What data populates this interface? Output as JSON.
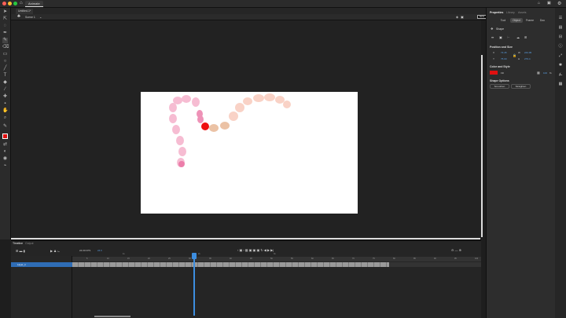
{
  "app": {
    "tab": "Animate",
    "document": "Untitled-1*",
    "scene": "Scene 1",
    "zoom": "50%"
  },
  "panel": {
    "tabs": [
      "Properties",
      "Library",
      "Assets"
    ],
    "subtabs": [
      "Tool",
      "Object",
      "Frame",
      "Doc"
    ],
    "object_type": "Shape",
    "position_size": {
      "title": "Position and Size",
      "x_label": "X",
      "x": "73.45",
      "y_label": "Y",
      "y": "75.00",
      "w_label": "W",
      "w": "243.95",
      "h_label": "H",
      "h": "279.4"
    },
    "color_style": {
      "title": "Color and Style",
      "fill_label": "Fill",
      "fill_color": "#e01010",
      "opacity": "100",
      "opacity_unit": "%"
    },
    "shape_options": {
      "title": "Shape Options",
      "smoothen": "Smoothen",
      "straighten": "Straighten"
    }
  },
  "timeline": {
    "tabs": [
      "Timeline",
      "Output"
    ],
    "fps": "24.00",
    "fps_unit": "FPS",
    "frame": "24",
    "frame_unit": "F",
    "layer": "Layer_1",
    "ruler_labels": [
      "1s",
      "2s",
      "3s"
    ],
    "frame_numbers": [
      "5",
      "10",
      "15",
      "20",
      "25",
      "30",
      "35",
      "40",
      "45",
      "50",
      "55",
      "60",
      "65",
      "70",
      "75",
      "80",
      "85",
      "90",
      "95",
      "100"
    ],
    "current_frame": 24
  }
}
